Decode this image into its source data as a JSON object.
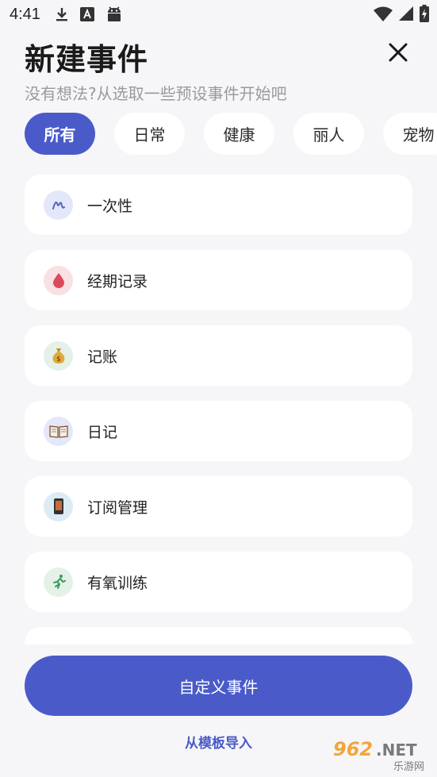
{
  "status_bar": {
    "time": "4:41",
    "left_icons": [
      "download-icon",
      "font-a-icon",
      "android-icon"
    ],
    "right_icons": [
      "wifi-icon",
      "signal-icon",
      "battery-icon"
    ]
  },
  "header": {
    "title": "新建事件",
    "subtitle": "没有想法?从选取一些预设事件开始吧",
    "close_icon": "close-icon"
  },
  "tabs": [
    {
      "label": "所有",
      "active": true
    },
    {
      "label": "日常",
      "active": false
    },
    {
      "label": "健康",
      "active": false
    },
    {
      "label": "丽人",
      "active": false
    },
    {
      "label": "宠物",
      "active": false
    }
  ],
  "events": [
    {
      "label": "一次性",
      "icon": "scribble-icon",
      "icon_bg": "#e4e7f7"
    },
    {
      "label": "经期记录",
      "icon": "blood-drop-icon",
      "icon_bg": "#f9e0e3"
    },
    {
      "label": "记账",
      "icon": "money-bag-icon",
      "icon_bg": "#e3f1e6"
    },
    {
      "label": "日记",
      "icon": "open-book-icon",
      "icon_bg": "#e4e7f7"
    },
    {
      "label": "订阅管理",
      "icon": "phone-icon",
      "icon_bg": "#dcecf5"
    },
    {
      "label": "有氧训练",
      "icon": "runner-icon",
      "icon_bg": "#e3f1e6"
    }
  ],
  "actions": {
    "custom_event": "自定义事件",
    "import_template": "从模板导入"
  },
  "colors": {
    "accent": "#4a5bc9",
    "background": "#f6f6f8",
    "card": "#ffffff"
  },
  "watermark": {
    "text": "962.NET",
    "sub": "乐游网"
  }
}
